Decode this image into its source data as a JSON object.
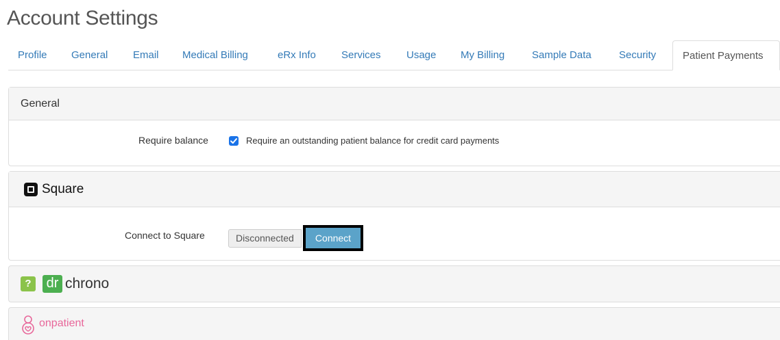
{
  "page_title": "Account Settings",
  "tabs": [
    {
      "label": "Profile"
    },
    {
      "label": "General"
    },
    {
      "label": "Email"
    },
    {
      "label": "Medical Billing"
    },
    {
      "label": "eRx Info"
    },
    {
      "label": "Services"
    },
    {
      "label": "Usage"
    },
    {
      "label": "My Billing"
    },
    {
      "label": "Sample Data"
    },
    {
      "label": "Security"
    },
    {
      "label": "Patient Payments",
      "active": true
    }
  ],
  "general_panel": {
    "title": "General",
    "require_balance_label": "Require balance",
    "require_balance_checked": true,
    "require_balance_text": "Require an outstanding patient balance for credit card payments"
  },
  "square_panel": {
    "brand": "Square",
    "logo_icon": "square-logo-icon",
    "connect_label": "Connect to Square",
    "status": "Disconnected",
    "connect_button": "Connect"
  },
  "drchrono_panel": {
    "help_icon": "question-icon",
    "logo_dr": "dr",
    "logo_text": "chrono"
  },
  "onpatient_panel": {
    "logo_icon": "onpatient-logo-icon",
    "logo_text": "onpatient"
  },
  "colors": {
    "link": "#337ab7",
    "checkbox": "#1a73e8",
    "connect_button": "#5ba3c9",
    "drchrono_green": "#4caf50",
    "help_green": "#8bc34a",
    "onpatient_pink": "#e8679a"
  }
}
